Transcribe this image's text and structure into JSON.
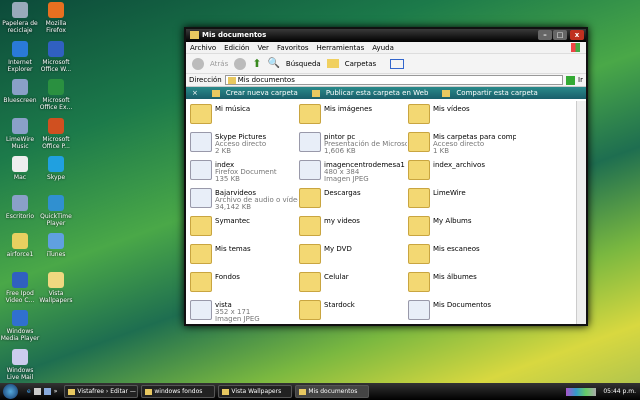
{
  "desktop": [
    {
      "label": "Papelera de reciclaje",
      "color": "#9ab"
    },
    {
      "label": "Mozilla Firefox",
      "color": "#e87020"
    },
    {
      "label": "Internet Explorer",
      "color": "#2a7ad8"
    },
    {
      "label": "Microsoft Office W...",
      "color": "#3060c0"
    },
    {
      "label": "Bluescreen",
      "color": "#8aa0c8"
    },
    {
      "label": "Microsoft Office Ex...",
      "color": "#2a9040"
    },
    {
      "label": "LimeWire Music",
      "color": "#8aa0c8"
    },
    {
      "label": "Microsoft Office P...",
      "color": "#d05020"
    },
    {
      "label": "Mac",
      "color": "#eee"
    },
    {
      "label": "Skype",
      "color": "#20a0e0"
    },
    {
      "label": "Escritorio",
      "color": "#8aa0c8"
    },
    {
      "label": "QuickTime Player",
      "color": "#3090d0"
    },
    {
      "label": "airforce1",
      "color": "#e8d060"
    },
    {
      "label": "iTunes",
      "color": "#60a0e0"
    },
    {
      "label": "Free Ipod Video C...",
      "color": "#3060c0"
    },
    {
      "label": "Vista Wallpapers",
      "color": "#f0d880"
    },
    {
      "label": "Windows Media Player",
      "color": "#3070d0"
    },
    {
      "label": "",
      "color": ""
    },
    {
      "label": "Windows Live Mail",
      "color": "#cce"
    }
  ],
  "window": {
    "title": "Mis documentos",
    "menu": [
      "Archivo",
      "Edición",
      "Ver",
      "Favoritos",
      "Herramientas",
      "Ayuda"
    ],
    "toolbar": {
      "back": "Atrás",
      "search": "Búsqueda",
      "folders": "Carpetas"
    },
    "address": {
      "label": "Dirección",
      "value": "Mis documentos",
      "go": "Ir"
    },
    "tasks": [
      "Crear nueva carpeta",
      "Publicar esta carpeta en Web",
      "Compartir esta carpeta"
    ],
    "items": [
      {
        "name": "Mi música"
      },
      {
        "name": "Mis imágenes"
      },
      {
        "name": "Mis vídeos"
      },
      {
        "name": "Skype Pictures",
        "l2": "Acceso directo",
        "l3": "2 KB",
        "file": true
      },
      {
        "name": "pintor pc",
        "l2": "Presentación de Microsoft Offi...",
        "l3": "1,606 KB",
        "file": true
      },
      {
        "name": "Mis carpetas para compartir",
        "l2": "Acceso directo",
        "l3": "1 KB"
      },
      {
        "name": "index",
        "l2": "Firefox Document",
        "l3": "135 KB",
        "file": true
      },
      {
        "name": "imagencentrodemesa1",
        "l2": "480 x 384",
        "l3": "Imagen JPEG",
        "file": true
      },
      {
        "name": "index_archivos"
      },
      {
        "name": "Bajarvideos",
        "l2": "Archivo de audio o vídeo de W...",
        "l3": "34,142 KB",
        "file": true
      },
      {
        "name": "Descargas"
      },
      {
        "name": "LimeWire"
      },
      {
        "name": "Symantec"
      },
      {
        "name": "my videos"
      },
      {
        "name": "My Albums"
      },
      {
        "name": "Mis temas"
      },
      {
        "name": "My DVD"
      },
      {
        "name": "Mis escaneos"
      },
      {
        "name": "Fondos"
      },
      {
        "name": "Celular"
      },
      {
        "name": "Mis álbumes"
      },
      {
        "name": "vista",
        "l2": "352 x 171",
        "l3": "Imagen JPEG",
        "file": true
      },
      {
        "name": "Stardock"
      },
      {
        "name": "Mis Documentos",
        "file": true
      }
    ]
  },
  "taskbar": {
    "buttons": [
      "Vistafree › Editar — W...",
      "windows fondos",
      "Vista Wallpapers",
      "Mis documentos"
    ],
    "clock": "05:44 p.m."
  }
}
